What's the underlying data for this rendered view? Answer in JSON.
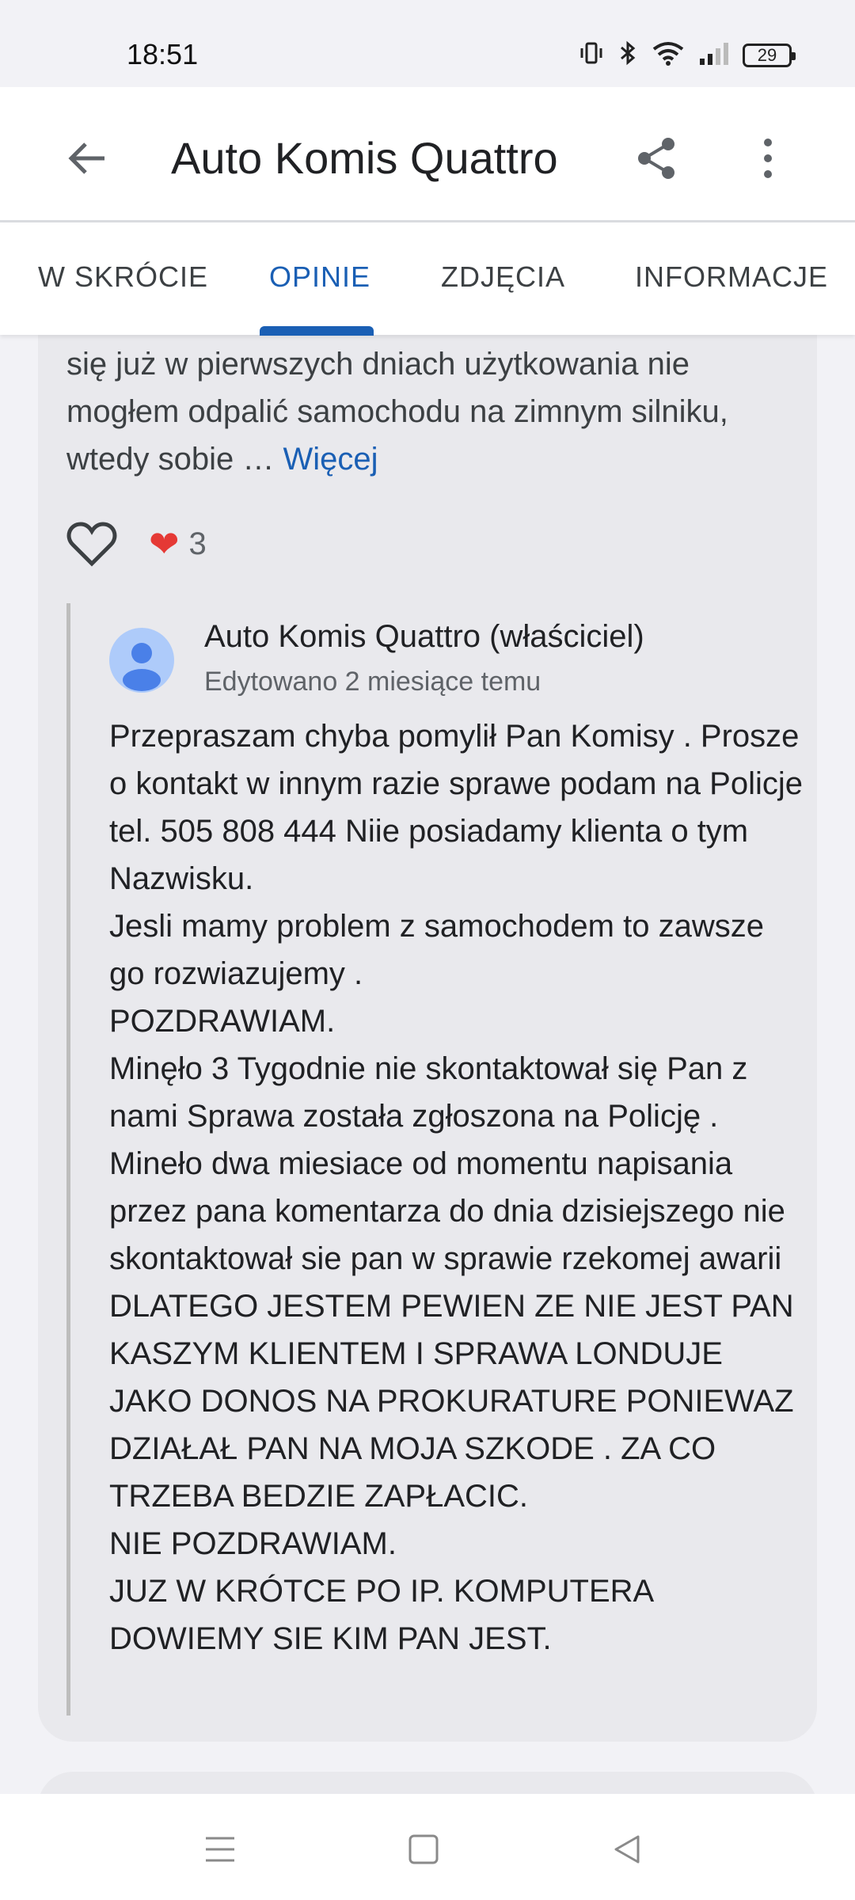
{
  "status_bar": {
    "time": "18:51",
    "battery": "29",
    "icons": [
      "vibrate-icon",
      "bluetooth-icon",
      "wifi-icon",
      "signal-icon",
      "battery-icon"
    ]
  },
  "header": {
    "title": "Auto Komis Quattro",
    "icons": [
      "back-arrow-icon",
      "share-icon",
      "more-vert-icon"
    ]
  },
  "tabs": [
    {
      "label": "W SKRÓCIE"
    },
    {
      "label": "OPINIE"
    },
    {
      "label": "ZDJĘCIA"
    },
    {
      "label": "INFORMACJE"
    }
  ],
  "review": {
    "text": "się już w pierwszych dniach użytkowania nie mogłem odpalić samochodu na zimnym silniku, wtedy sobie … ",
    "more_label": "Więcej",
    "reaction_count": "3"
  },
  "owner_reply": {
    "name": "Auto Komis Quattro (właściciel)",
    "edited": "Edytowano 2 miesiące temu",
    "lines": [
      "Przepraszam chyba pomylił Pan Komisy . Prosze o kontakt w innym razie sprawe podam na Policje tel. 505 808 444 Niie posiadamy klienta o tym Nazwisku.",
      "Jesli mamy problem z samochodem to zawsze go rozwiazujemy .",
      "POZDRAWIAM.",
      "Minęło 3 Tygodnie nie skontaktował się Pan z nami Sprawa została zgłoszona na Policję . Mineło dwa miesiace od momentu napisania przez pana komentarza do dnia dzisiejszego nie skontaktował sie pan w sprawie rzekomej awarii",
      "DLATEGO JESTEM PEWIEN ZE NIE JEST PAN KASZYM KLIENTEM I SPRAWA LONDUJE JAKO DONOS NA PROKURATURE PONIEWAZ DZIAŁAŁ PAN NA MOJA SZKODE . ZA CO TRZEBA BEDZIE ZAPŁACIC.",
      "NIE POZDRAWIAM.",
      "JUZ W KRÓTCE PO IP. KOMPUTERA DOWIEMY SIE KIM PAN JEST."
    ]
  },
  "colors": {
    "accent": "#1a5fb4",
    "background": "#f2f2f6",
    "card": "#e9e9ed"
  }
}
